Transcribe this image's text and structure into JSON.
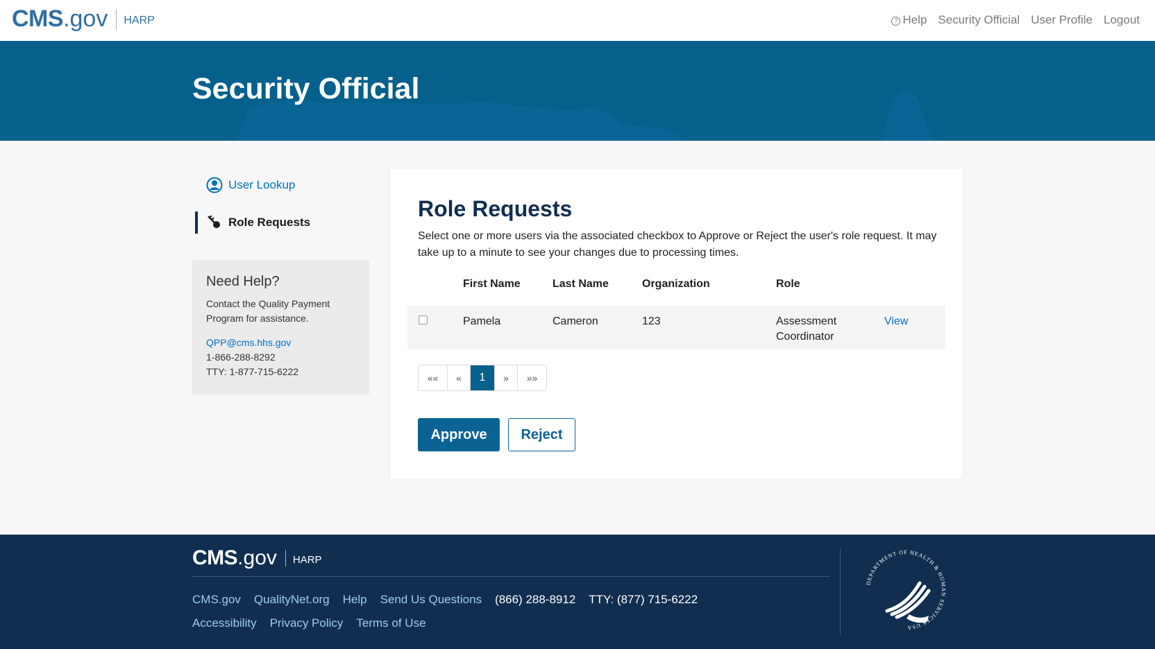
{
  "header": {
    "logo_cms": "CMS",
    "logo_gov": ".gov",
    "logo_harp": "HARP",
    "nav": {
      "help": "Help",
      "security_official": "Security Official",
      "user_profile": "User Profile",
      "logout": "Logout"
    }
  },
  "hero": {
    "title": "Security Official"
  },
  "sidebar": {
    "items": [
      {
        "label": "User Lookup",
        "active": false
      },
      {
        "label": "Role Requests",
        "active": true
      }
    ],
    "help": {
      "title": "Need Help?",
      "text": "Contact the Quality Payment Program for assistance.",
      "email": "QPP@cms.hhs.gov",
      "phone": "1-866-288-8292",
      "tty": "TTY: 1-877-715-6222"
    }
  },
  "main": {
    "title": "Role Requests",
    "description": "Select one or more users via the associated checkbox to Approve or Reject the user's role request. It may take up to a minute to see your changes due to processing times.",
    "table": {
      "headers": {
        "first_name": "First Name",
        "last_name": "Last Name",
        "organization": "Organization",
        "role": "Role"
      },
      "rows": [
        {
          "first_name": "Pamela",
          "last_name": "Cameron",
          "organization": "123",
          "role": "Assessment Coordinator",
          "action": "View",
          "checked": false
        }
      ]
    },
    "pagination": {
      "first": "««",
      "prev": "«",
      "current": "1",
      "next": "»",
      "last": "»»"
    },
    "buttons": {
      "approve": "Approve",
      "reject": "Reject"
    }
  },
  "footer": {
    "logo_cms": "CMS",
    "logo_gov": ".gov",
    "logo_harp": "HARP",
    "links": {
      "cms": "CMS.gov",
      "qualitynet": "QualityNet.org",
      "help": "Help",
      "send_questions": "Send Us Questions",
      "phone": "(866) 288-8912",
      "tty": "TTY: (877) 715-6222",
      "accessibility": "Accessibility",
      "privacy": "Privacy Policy",
      "terms": "Terms of Use"
    },
    "seal_text": "DEPARTMENT OF HEALTH & HUMAN SERVICES USA"
  },
  "colors": {
    "brand_blue": "#05608c",
    "footer_navy": "#112e51",
    "link_blue": "#0071bc",
    "button_blue": "#0b6394"
  }
}
